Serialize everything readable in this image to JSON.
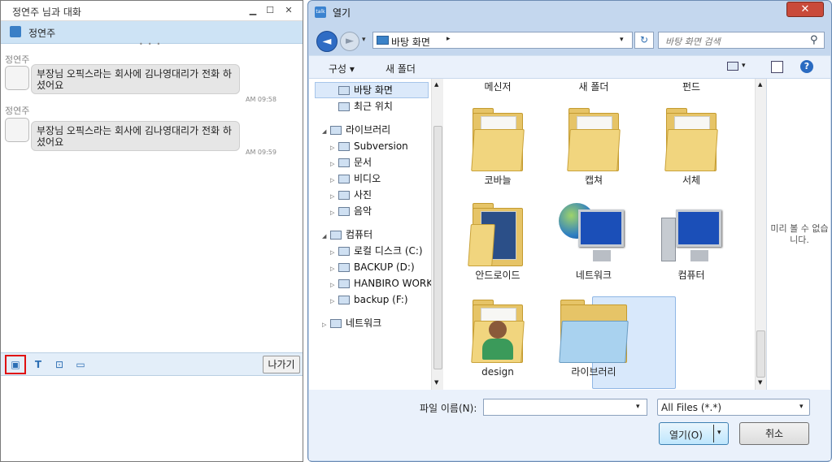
{
  "chat": {
    "title": "정연주 님과 대화",
    "win_min": "▁",
    "win_max": "☐",
    "win_close": "✕",
    "partner": "정연주",
    "messages": [
      {
        "sender": "정연주",
        "text": "부장님 오픽스라는 회사에 김나영대리가 전화 하셨어요",
        "time": "AM 09:58"
      },
      {
        "sender": "정연주",
        "text": "부장님 오픽스라는 회사에 김나영대리가 전화 하셨어요",
        "time": "AM 09:59"
      }
    ],
    "toolbar": {
      "file_icon": "▣",
      "text_icon": "T",
      "image_icon": "⊡",
      "screen_icon": "▭",
      "leave": "나가기"
    }
  },
  "dialog": {
    "app_icon": "talk",
    "title": "열기",
    "close": "✕",
    "nav": {
      "back": "◄",
      "forward": "►",
      "history": "▾"
    },
    "address": {
      "location": "바탕 화면",
      "arrow": "▸",
      "dropdown": "▾",
      "refresh": "↻"
    },
    "search_placeholder": "바탕 화면 검색",
    "search_icon": "⚲",
    "commands": {
      "organize": "구성 ▾",
      "new_folder": "새 폴더",
      "views_dropdown": "▾",
      "help": "?"
    },
    "nav_tree": [
      {
        "label": "바탕 화면",
        "indent": 1,
        "toggle": ""
      },
      {
        "label": "최근 위치",
        "indent": 1,
        "toggle": ""
      },
      {
        "label": "라이브러리",
        "indent": 0,
        "toggle": "◢"
      },
      {
        "label": "Subversion",
        "indent": 1,
        "toggle": "▷"
      },
      {
        "label": "문서",
        "indent": 1,
        "toggle": "▷"
      },
      {
        "label": "비디오",
        "indent": 1,
        "toggle": "▷"
      },
      {
        "label": "사진",
        "indent": 1,
        "toggle": "▷"
      },
      {
        "label": "음악",
        "indent": 1,
        "toggle": "▷"
      },
      {
        "label": "컴퓨터",
        "indent": 0,
        "toggle": "◢"
      },
      {
        "label": "로컬 디스크 (C:)",
        "indent": 1,
        "toggle": "▷"
      },
      {
        "label": "BACKUP (D:)",
        "indent": 1,
        "toggle": "▷"
      },
      {
        "label": "HANBIRO WORK",
        "indent": 1,
        "toggle": "▷"
      },
      {
        "label": "backup (F:)",
        "indent": 1,
        "toggle": "▷"
      },
      {
        "label": "네트워크",
        "indent": 0,
        "toggle": "▷"
      }
    ],
    "files_top_row": [
      "메신저",
      "새 폴더",
      "펀드"
    ],
    "files": [
      "코바늘",
      "캡쳐",
      "서체",
      "안드로이드",
      "네트워크",
      "컴퓨터",
      "design",
      "라이브러리"
    ],
    "preview_text": "미리 볼 수 없습니다.",
    "filename_label": "파일 이름(N):",
    "filename_value": "",
    "filename_dropdown": "▾",
    "filetype": "All Files (*.*)",
    "filetype_dropdown": "▾",
    "open": "열기(O)",
    "open_dropdown": "▾",
    "cancel": "취소",
    "scroll_up": "▲",
    "scroll_down": "▼"
  }
}
